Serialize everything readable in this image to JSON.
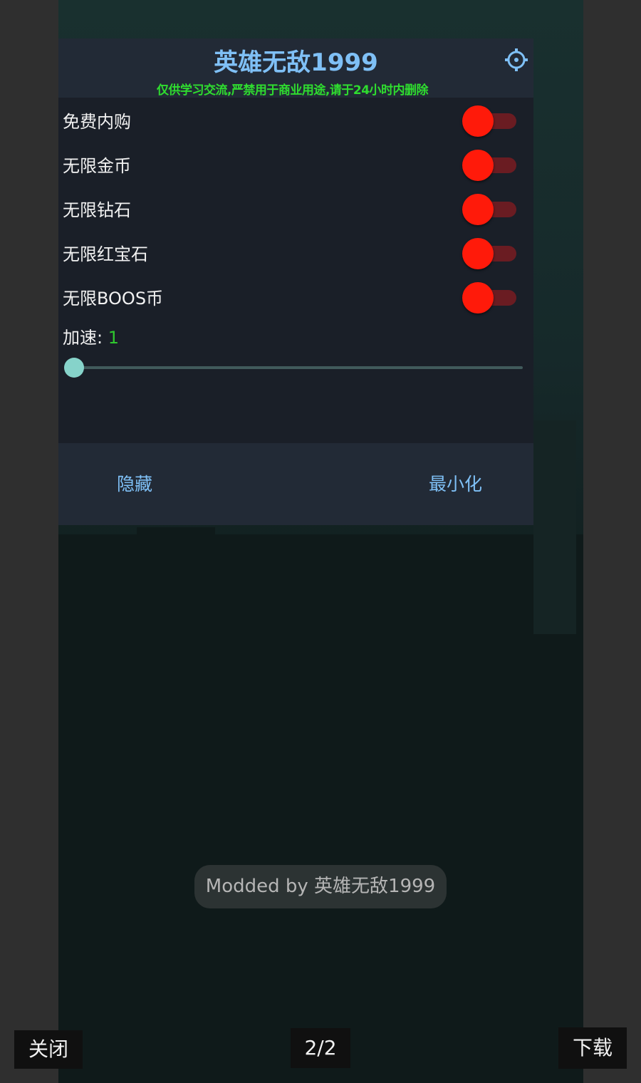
{
  "menu": {
    "title": "英雄无敌1999",
    "subtitle": "仅供学习交流,严禁用于商业用途,请于24小时内删除",
    "settings_icon": "gear-icon",
    "toggles": [
      {
        "label": "免费内购",
        "on": false
      },
      {
        "label": "无限金币",
        "on": false
      },
      {
        "label": "无限钻石",
        "on": false
      },
      {
        "label": "无限红宝石",
        "on": false
      },
      {
        "label": "无限BOOS币",
        "on": false
      }
    ],
    "speed": {
      "label": "加速:",
      "value": "1",
      "fraction": 0.0
    },
    "hide_label": "隐藏",
    "minimize_label": "最小化"
  },
  "toast": "Modded by 英雄无敌1999",
  "viewer": {
    "close_label": "关闭",
    "page_indicator": "2/2",
    "download_label": "下载"
  },
  "colors": {
    "accent": "#7fc0f6",
    "subtitle": "#2fdc2f",
    "toggle_thumb": "#ff1a0a",
    "toggle_track": "#6a1c22",
    "slider": "#86d3ca"
  }
}
